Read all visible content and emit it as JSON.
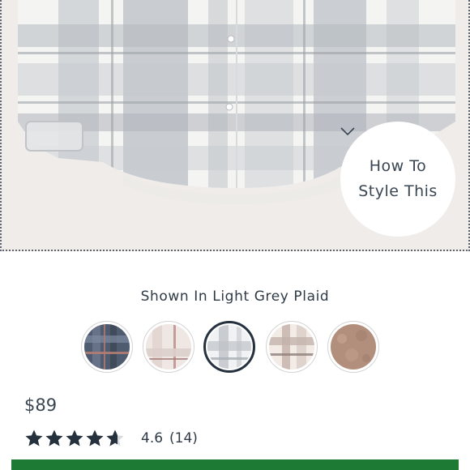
{
  "style_prompt": {
    "line1": "How To",
    "line2": "Style This",
    "icon": "chevron-down-icon"
  },
  "color": {
    "shown_in_label": "Shown In Light Grey Plaid",
    "selected_index": 2,
    "swatches": [
      {
        "name": "navy-plaid",
        "base": "#4f5b6f",
        "accent": "#8a7a86"
      },
      {
        "name": "cream-plaid",
        "base": "#efe7e4",
        "accent": "#c9a4a0"
      },
      {
        "name": "light-grey-plaid",
        "base": "#f1f2f3",
        "accent": "#b3b8be"
      },
      {
        "name": "tan-plaid",
        "base": "#f2ebe6",
        "accent": "#b49f97"
      },
      {
        "name": "camel-sherpa",
        "base": "#b28f7c",
        "accent": "#c7a694"
      }
    ]
  },
  "product": {
    "price": "$89",
    "rating_value": "4.6",
    "rating_count": "(14)",
    "rating_stars": 4.6,
    "star_color": "#25313d"
  },
  "cta": {
    "color": "#1d7a35"
  }
}
